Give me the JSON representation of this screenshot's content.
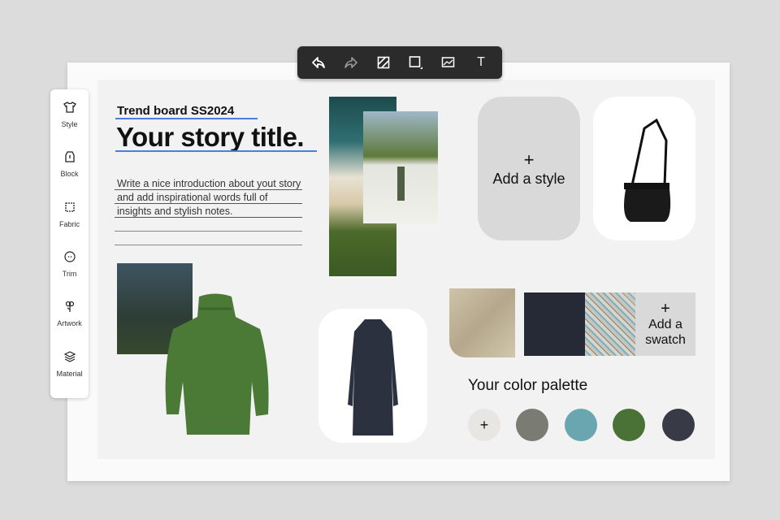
{
  "toolbar": {
    "tools": [
      "undo-icon",
      "redo-icon",
      "fill-icon",
      "shape-icon",
      "image-icon",
      "text-icon"
    ],
    "text_label": "T"
  },
  "sidebar": {
    "items": [
      {
        "label": "Style",
        "icon": "tshirt-icon"
      },
      {
        "label": "Block",
        "icon": "block-icon"
      },
      {
        "label": "Fabric",
        "icon": "fabric-icon"
      },
      {
        "label": "Trim",
        "icon": "button-icon"
      },
      {
        "label": "Artwork",
        "icon": "flower-icon"
      },
      {
        "label": "Material",
        "icon": "layers-icon"
      }
    ]
  },
  "board": {
    "subtitle": "Trend board SS2024",
    "title": "Your story title.",
    "intro": [
      "Write a nice introduction about yout story",
      "and add inspirational words full of",
      "insights and stylish notes."
    ],
    "add_style": {
      "plus": "+",
      "label": "Add a style"
    },
    "add_swatch": {
      "plus": "+",
      "label1": "Add a",
      "label2": "swatch"
    },
    "palette": {
      "title": "Your color palette",
      "add": "+",
      "colors": [
        "#7a7b73",
        "#69a6b0",
        "#4a7136",
        "#383a45"
      ]
    }
  },
  "colors": {
    "toolbar": "#2b2b2b",
    "underline": "#4a7fe0",
    "card": "#d9d9d9"
  }
}
